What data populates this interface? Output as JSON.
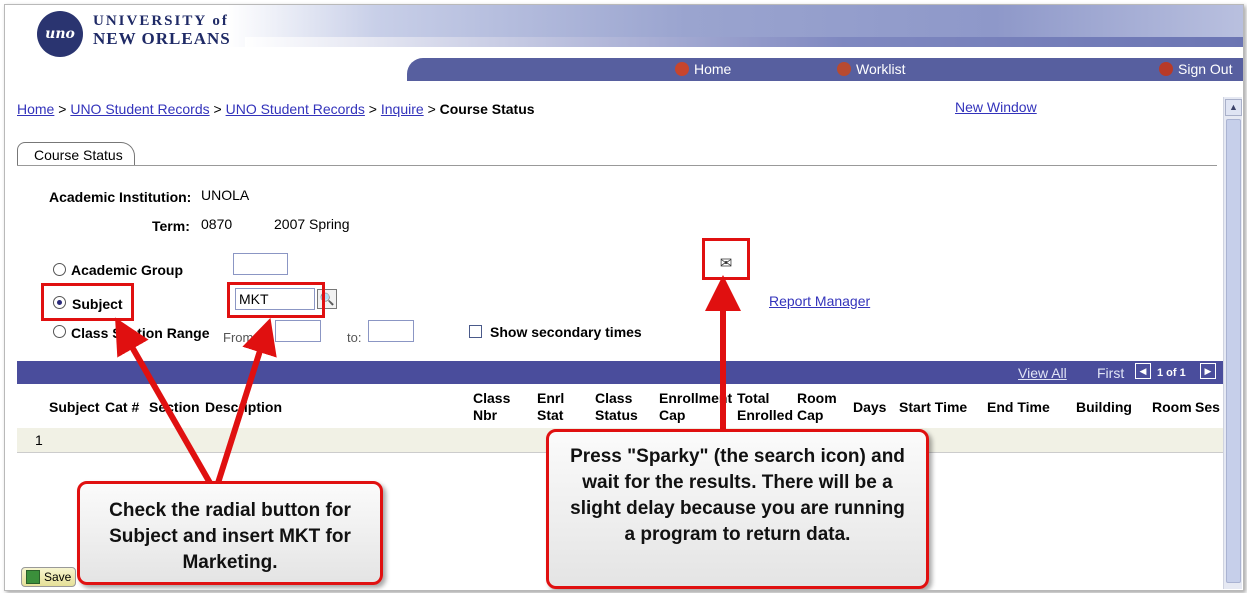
{
  "header": {
    "logo_text": "uno",
    "university_line1": "UNIVERSITY of",
    "university_line2": "NEW ORLEANS",
    "nav": [
      {
        "label": "Home"
      },
      {
        "label": "Worklist"
      },
      {
        "label": "Sign Out"
      }
    ]
  },
  "breadcrumb": {
    "items": [
      "Home",
      "UNO Student Records",
      "UNO Student Records",
      "Inquire"
    ],
    "separator": ">",
    "current": "Course Status"
  },
  "new_window": "New Window",
  "tab": {
    "label": "Course Status"
  },
  "form": {
    "institution_label": "Academic Institution:",
    "institution_value": "UNOLA",
    "term_label": "Term:",
    "term_code": "0870",
    "term_desc": "2007 Spring",
    "academic_group_label": "Academic Group",
    "academic_group_value": "",
    "subject_label": "Subject",
    "subject_value": "MKT",
    "class_section_label": "Class Section Range",
    "from_label": "From:",
    "to_label": "to:",
    "from_value": "",
    "to_value": "",
    "show_secondary_label": "Show secondary times",
    "show_secondary_checked": false,
    "selected_radio": "subject"
  },
  "report_manager": "Report Manager",
  "grid": {
    "view_all": "View All",
    "first": "First",
    "page_info": "1 of 1",
    "columns": [
      "Subject",
      "Cat #",
      "Section",
      "Description",
      "Class Nbr",
      "Enrl Stat",
      "Class Status",
      "Enrollment Cap",
      "Total Enrolled",
      "Room Cap",
      "Days",
      "Start Time",
      "End Time",
      "Building",
      "Room",
      "Ses"
    ],
    "rows": [
      [
        "1"
      ]
    ]
  },
  "save_label": "Save",
  "callouts": {
    "left": "Check the radial button for Subject and insert MKT for Marketing.",
    "right": "Press \"Sparky\" (the search icon) and wait for the results. There will be a slight delay because you are running a program to return data."
  },
  "colors": {
    "nav": "#575f9f",
    "grid_bar": "#4a4d9c",
    "link": "#3333bb",
    "callout_border": "#e01010"
  }
}
